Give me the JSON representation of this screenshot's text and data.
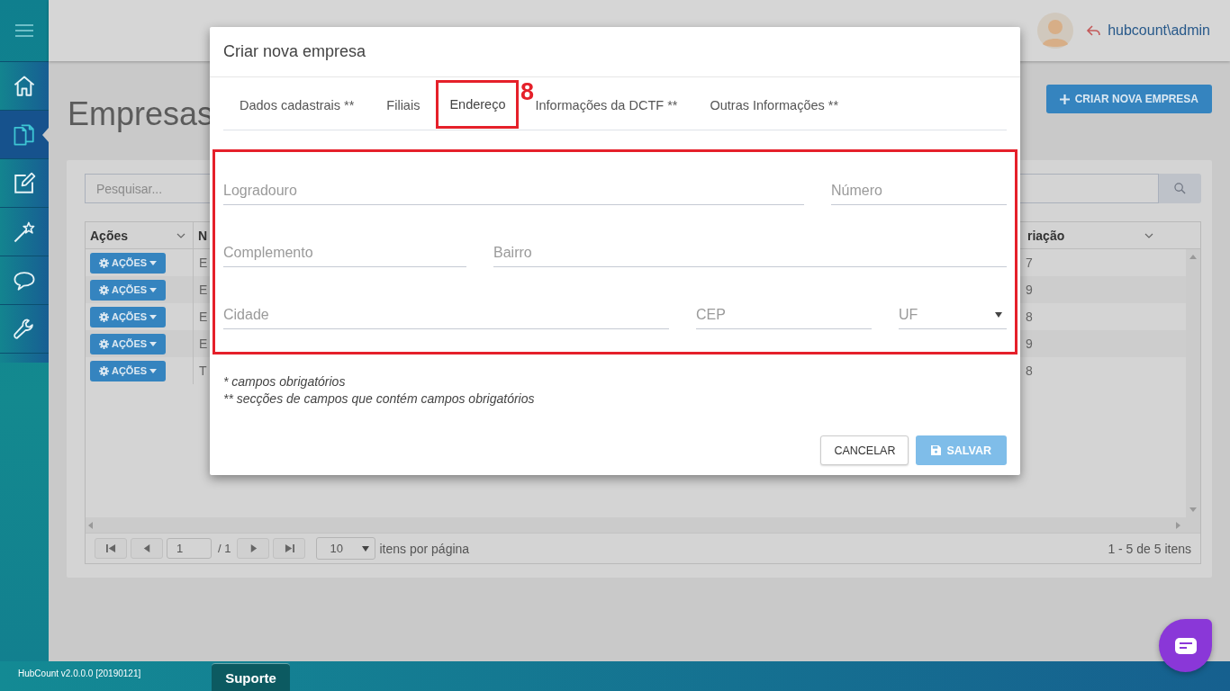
{
  "sidebar": {
    "items": [
      {
        "selected": false
      },
      {
        "selected": true
      },
      {
        "selected": false
      },
      {
        "selected": false
      },
      {
        "selected": false
      },
      {
        "selected": false
      }
    ]
  },
  "header": {
    "user": "hubcount\\admin"
  },
  "page": {
    "title": "Empresas",
    "create_button": "CRIAR NOVA EMPRESA",
    "search": {
      "placeholder": "Pesquisar..."
    },
    "grid": {
      "columns": [
        "Ações",
        "N",
        "riação"
      ],
      "rows": [
        {
          "action": "AÇÕES",
          "column_2": "E",
          "column_3": "7"
        },
        {
          "action": "AÇÕES",
          "column_2": "E",
          "column_3": "9"
        },
        {
          "action": "AÇÕES",
          "column_2": "E",
          "column_3": "8"
        },
        {
          "action": "AÇÕES",
          "column_2": "E",
          "column_3": "9"
        },
        {
          "action": "AÇÕES",
          "column_2": "T",
          "column_3": "8"
        }
      ]
    },
    "pager": {
      "page": "1",
      "of": "/ 1",
      "page_size": "10",
      "page_size_label": "itens por página",
      "summary": "1 - 5 de 5 itens"
    }
  },
  "modal": {
    "title": "Criar nova empresa",
    "annotation": "8",
    "highlighted": true,
    "tabs": [
      {
        "label": "Dados cadastrais **",
        "selected": false
      },
      {
        "label": "Filiais",
        "selected": false
      },
      {
        "label": "Endereço",
        "selected": true
      },
      {
        "label": "Informações da DCTF **",
        "selected": false
      },
      {
        "label": "Outras Informações **",
        "selected": false
      }
    ],
    "fields": [
      [
        {
          "placeholder": "Logradouro",
          "kind": "text"
        },
        {
          "placeholder": "Número",
          "kind": "text"
        }
      ],
      [
        {
          "placeholder": "Complemento",
          "kind": "text"
        },
        {
          "placeholder": "Bairro",
          "kind": "text"
        }
      ],
      [
        {
          "placeholder": "Cidade",
          "kind": "text"
        },
        {
          "placeholder": "CEP",
          "kind": "text"
        },
        {
          "placeholder": "UF",
          "kind": "select"
        }
      ]
    ],
    "notes": [
      "* campos obrigatórios",
      "** secções de campos que contém campos obrigatórios"
    ],
    "buttons": [
      {
        "label": "CANCELAR",
        "kind": "secondary",
        "disabled": false
      },
      {
        "label": "SALVAR",
        "kind": "primary",
        "disabled": true
      }
    ]
  },
  "footer": {
    "version": "HubCount v2.0.0.0 [20190121]",
    "support": "Suporte"
  }
}
